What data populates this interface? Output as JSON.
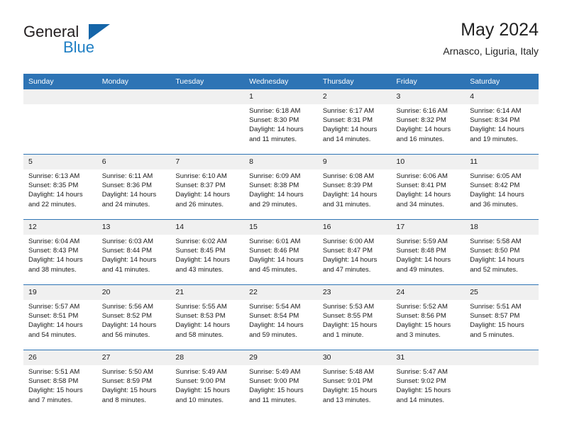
{
  "brand": {
    "name_part1": "General",
    "name_part2": "Blue",
    "logo_icon": "triangle-logo-icon"
  },
  "header": {
    "title": "May 2024",
    "subtitle": "Arnasco, Liguria, Italy"
  },
  "weekday_headers": [
    "Sunday",
    "Monday",
    "Tuesday",
    "Wednesday",
    "Thursday",
    "Friday",
    "Saturday"
  ],
  "colors": {
    "header_blue": "#2e74b5",
    "brand_blue": "#1f7fc4",
    "daynum_band": "#f0f0f0"
  },
  "labels": {
    "sunrise": "Sunrise:",
    "sunset": "Sunset:",
    "daylight": "Daylight:"
  },
  "weeks": [
    [
      {
        "day": "",
        "empty": true
      },
      {
        "day": "",
        "empty": true
      },
      {
        "day": "",
        "empty": true
      },
      {
        "day": "1",
        "sunrise": "Sunrise: 6:18 AM",
        "sunset": "Sunset: 8:30 PM",
        "daylight": "Daylight: 14 hours and 11 minutes."
      },
      {
        "day": "2",
        "sunrise": "Sunrise: 6:17 AM",
        "sunset": "Sunset: 8:31 PM",
        "daylight": "Daylight: 14 hours and 14 minutes."
      },
      {
        "day": "3",
        "sunrise": "Sunrise: 6:16 AM",
        "sunset": "Sunset: 8:32 PM",
        "daylight": "Daylight: 14 hours and 16 minutes."
      },
      {
        "day": "4",
        "sunrise": "Sunrise: 6:14 AM",
        "sunset": "Sunset: 8:34 PM",
        "daylight": "Daylight: 14 hours and 19 minutes."
      }
    ],
    [
      {
        "day": "5",
        "sunrise": "Sunrise: 6:13 AM",
        "sunset": "Sunset: 8:35 PM",
        "daylight": "Daylight: 14 hours and 22 minutes."
      },
      {
        "day": "6",
        "sunrise": "Sunrise: 6:11 AM",
        "sunset": "Sunset: 8:36 PM",
        "daylight": "Daylight: 14 hours and 24 minutes."
      },
      {
        "day": "7",
        "sunrise": "Sunrise: 6:10 AM",
        "sunset": "Sunset: 8:37 PM",
        "daylight": "Daylight: 14 hours and 26 minutes."
      },
      {
        "day": "8",
        "sunrise": "Sunrise: 6:09 AM",
        "sunset": "Sunset: 8:38 PM",
        "daylight": "Daylight: 14 hours and 29 minutes."
      },
      {
        "day": "9",
        "sunrise": "Sunrise: 6:08 AM",
        "sunset": "Sunset: 8:39 PM",
        "daylight": "Daylight: 14 hours and 31 minutes."
      },
      {
        "day": "10",
        "sunrise": "Sunrise: 6:06 AM",
        "sunset": "Sunset: 8:41 PM",
        "daylight": "Daylight: 14 hours and 34 minutes."
      },
      {
        "day": "11",
        "sunrise": "Sunrise: 6:05 AM",
        "sunset": "Sunset: 8:42 PM",
        "daylight": "Daylight: 14 hours and 36 minutes."
      }
    ],
    [
      {
        "day": "12",
        "sunrise": "Sunrise: 6:04 AM",
        "sunset": "Sunset: 8:43 PM",
        "daylight": "Daylight: 14 hours and 38 minutes."
      },
      {
        "day": "13",
        "sunrise": "Sunrise: 6:03 AM",
        "sunset": "Sunset: 8:44 PM",
        "daylight": "Daylight: 14 hours and 41 minutes."
      },
      {
        "day": "14",
        "sunrise": "Sunrise: 6:02 AM",
        "sunset": "Sunset: 8:45 PM",
        "daylight": "Daylight: 14 hours and 43 minutes."
      },
      {
        "day": "15",
        "sunrise": "Sunrise: 6:01 AM",
        "sunset": "Sunset: 8:46 PM",
        "daylight": "Daylight: 14 hours and 45 minutes."
      },
      {
        "day": "16",
        "sunrise": "Sunrise: 6:00 AM",
        "sunset": "Sunset: 8:47 PM",
        "daylight": "Daylight: 14 hours and 47 minutes."
      },
      {
        "day": "17",
        "sunrise": "Sunrise: 5:59 AM",
        "sunset": "Sunset: 8:48 PM",
        "daylight": "Daylight: 14 hours and 49 minutes."
      },
      {
        "day": "18",
        "sunrise": "Sunrise: 5:58 AM",
        "sunset": "Sunset: 8:50 PM",
        "daylight": "Daylight: 14 hours and 52 minutes."
      }
    ],
    [
      {
        "day": "19",
        "sunrise": "Sunrise: 5:57 AM",
        "sunset": "Sunset: 8:51 PM",
        "daylight": "Daylight: 14 hours and 54 minutes."
      },
      {
        "day": "20",
        "sunrise": "Sunrise: 5:56 AM",
        "sunset": "Sunset: 8:52 PM",
        "daylight": "Daylight: 14 hours and 56 minutes."
      },
      {
        "day": "21",
        "sunrise": "Sunrise: 5:55 AM",
        "sunset": "Sunset: 8:53 PM",
        "daylight": "Daylight: 14 hours and 58 minutes."
      },
      {
        "day": "22",
        "sunrise": "Sunrise: 5:54 AM",
        "sunset": "Sunset: 8:54 PM",
        "daylight": "Daylight: 14 hours and 59 minutes."
      },
      {
        "day": "23",
        "sunrise": "Sunrise: 5:53 AM",
        "sunset": "Sunset: 8:55 PM",
        "daylight": "Daylight: 15 hours and 1 minute."
      },
      {
        "day": "24",
        "sunrise": "Sunrise: 5:52 AM",
        "sunset": "Sunset: 8:56 PM",
        "daylight": "Daylight: 15 hours and 3 minutes."
      },
      {
        "day": "25",
        "sunrise": "Sunrise: 5:51 AM",
        "sunset": "Sunset: 8:57 PM",
        "daylight": "Daylight: 15 hours and 5 minutes."
      }
    ],
    [
      {
        "day": "26",
        "sunrise": "Sunrise: 5:51 AM",
        "sunset": "Sunset: 8:58 PM",
        "daylight": "Daylight: 15 hours and 7 minutes."
      },
      {
        "day": "27",
        "sunrise": "Sunrise: 5:50 AM",
        "sunset": "Sunset: 8:59 PM",
        "daylight": "Daylight: 15 hours and 8 minutes."
      },
      {
        "day": "28",
        "sunrise": "Sunrise: 5:49 AM",
        "sunset": "Sunset: 9:00 PM",
        "daylight": "Daylight: 15 hours and 10 minutes."
      },
      {
        "day": "29",
        "sunrise": "Sunrise: 5:49 AM",
        "sunset": "Sunset: 9:00 PM",
        "daylight": "Daylight: 15 hours and 11 minutes."
      },
      {
        "day": "30",
        "sunrise": "Sunrise: 5:48 AM",
        "sunset": "Sunset: 9:01 PM",
        "daylight": "Daylight: 15 hours and 13 minutes."
      },
      {
        "day": "31",
        "sunrise": "Sunrise: 5:47 AM",
        "sunset": "Sunset: 9:02 PM",
        "daylight": "Daylight: 15 hours and 14 minutes."
      },
      {
        "day": "",
        "empty": true
      }
    ]
  ]
}
